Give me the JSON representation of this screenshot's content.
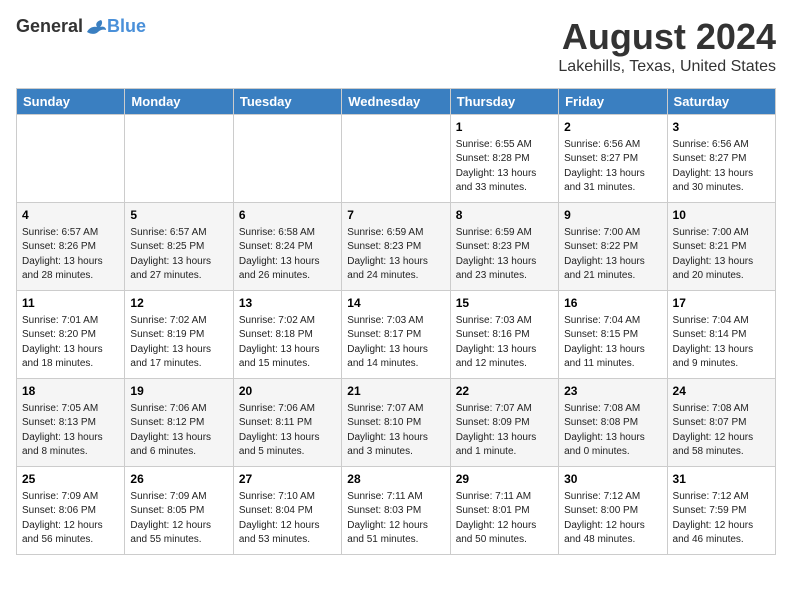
{
  "header": {
    "logo_general": "General",
    "logo_blue": "Blue",
    "month_title": "August 2024",
    "location": "Lakehills, Texas, United States"
  },
  "calendar": {
    "days_of_week": [
      "Sunday",
      "Monday",
      "Tuesday",
      "Wednesday",
      "Thursday",
      "Friday",
      "Saturday"
    ],
    "weeks": [
      {
        "days": [
          {
            "number": "",
            "info": ""
          },
          {
            "number": "",
            "info": ""
          },
          {
            "number": "",
            "info": ""
          },
          {
            "number": "",
            "info": ""
          },
          {
            "number": "1",
            "info": "Sunrise: 6:55 AM\nSunset: 8:28 PM\nDaylight: 13 hours\nand 33 minutes."
          },
          {
            "number": "2",
            "info": "Sunrise: 6:56 AM\nSunset: 8:27 PM\nDaylight: 13 hours\nand 31 minutes."
          },
          {
            "number": "3",
            "info": "Sunrise: 6:56 AM\nSunset: 8:27 PM\nDaylight: 13 hours\nand 30 minutes."
          }
        ]
      },
      {
        "days": [
          {
            "number": "4",
            "info": "Sunrise: 6:57 AM\nSunset: 8:26 PM\nDaylight: 13 hours\nand 28 minutes."
          },
          {
            "number": "5",
            "info": "Sunrise: 6:57 AM\nSunset: 8:25 PM\nDaylight: 13 hours\nand 27 minutes."
          },
          {
            "number": "6",
            "info": "Sunrise: 6:58 AM\nSunset: 8:24 PM\nDaylight: 13 hours\nand 26 minutes."
          },
          {
            "number": "7",
            "info": "Sunrise: 6:59 AM\nSunset: 8:23 PM\nDaylight: 13 hours\nand 24 minutes."
          },
          {
            "number": "8",
            "info": "Sunrise: 6:59 AM\nSunset: 8:23 PM\nDaylight: 13 hours\nand 23 minutes."
          },
          {
            "number": "9",
            "info": "Sunrise: 7:00 AM\nSunset: 8:22 PM\nDaylight: 13 hours\nand 21 minutes."
          },
          {
            "number": "10",
            "info": "Sunrise: 7:00 AM\nSunset: 8:21 PM\nDaylight: 13 hours\nand 20 minutes."
          }
        ]
      },
      {
        "days": [
          {
            "number": "11",
            "info": "Sunrise: 7:01 AM\nSunset: 8:20 PM\nDaylight: 13 hours\nand 18 minutes."
          },
          {
            "number": "12",
            "info": "Sunrise: 7:02 AM\nSunset: 8:19 PM\nDaylight: 13 hours\nand 17 minutes."
          },
          {
            "number": "13",
            "info": "Sunrise: 7:02 AM\nSunset: 8:18 PM\nDaylight: 13 hours\nand 15 minutes."
          },
          {
            "number": "14",
            "info": "Sunrise: 7:03 AM\nSunset: 8:17 PM\nDaylight: 13 hours\nand 14 minutes."
          },
          {
            "number": "15",
            "info": "Sunrise: 7:03 AM\nSunset: 8:16 PM\nDaylight: 13 hours\nand 12 minutes."
          },
          {
            "number": "16",
            "info": "Sunrise: 7:04 AM\nSunset: 8:15 PM\nDaylight: 13 hours\nand 11 minutes."
          },
          {
            "number": "17",
            "info": "Sunrise: 7:04 AM\nSunset: 8:14 PM\nDaylight: 13 hours\nand 9 minutes."
          }
        ]
      },
      {
        "days": [
          {
            "number": "18",
            "info": "Sunrise: 7:05 AM\nSunset: 8:13 PM\nDaylight: 13 hours\nand 8 minutes."
          },
          {
            "number": "19",
            "info": "Sunrise: 7:06 AM\nSunset: 8:12 PM\nDaylight: 13 hours\nand 6 minutes."
          },
          {
            "number": "20",
            "info": "Sunrise: 7:06 AM\nSunset: 8:11 PM\nDaylight: 13 hours\nand 5 minutes."
          },
          {
            "number": "21",
            "info": "Sunrise: 7:07 AM\nSunset: 8:10 PM\nDaylight: 13 hours\nand 3 minutes."
          },
          {
            "number": "22",
            "info": "Sunrise: 7:07 AM\nSunset: 8:09 PM\nDaylight: 13 hours\nand 1 minute."
          },
          {
            "number": "23",
            "info": "Sunrise: 7:08 AM\nSunset: 8:08 PM\nDaylight: 13 hours\nand 0 minutes."
          },
          {
            "number": "24",
            "info": "Sunrise: 7:08 AM\nSunset: 8:07 PM\nDaylight: 12 hours\nand 58 minutes."
          }
        ]
      },
      {
        "days": [
          {
            "number": "25",
            "info": "Sunrise: 7:09 AM\nSunset: 8:06 PM\nDaylight: 12 hours\nand 56 minutes."
          },
          {
            "number": "26",
            "info": "Sunrise: 7:09 AM\nSunset: 8:05 PM\nDaylight: 12 hours\nand 55 minutes."
          },
          {
            "number": "27",
            "info": "Sunrise: 7:10 AM\nSunset: 8:04 PM\nDaylight: 12 hours\nand 53 minutes."
          },
          {
            "number": "28",
            "info": "Sunrise: 7:11 AM\nSunset: 8:03 PM\nDaylight: 12 hours\nand 51 minutes."
          },
          {
            "number": "29",
            "info": "Sunrise: 7:11 AM\nSunset: 8:01 PM\nDaylight: 12 hours\nand 50 minutes."
          },
          {
            "number": "30",
            "info": "Sunrise: 7:12 AM\nSunset: 8:00 PM\nDaylight: 12 hours\nand 48 minutes."
          },
          {
            "number": "31",
            "info": "Sunrise: 7:12 AM\nSunset: 7:59 PM\nDaylight: 12 hours\nand 46 minutes."
          }
        ]
      }
    ]
  }
}
